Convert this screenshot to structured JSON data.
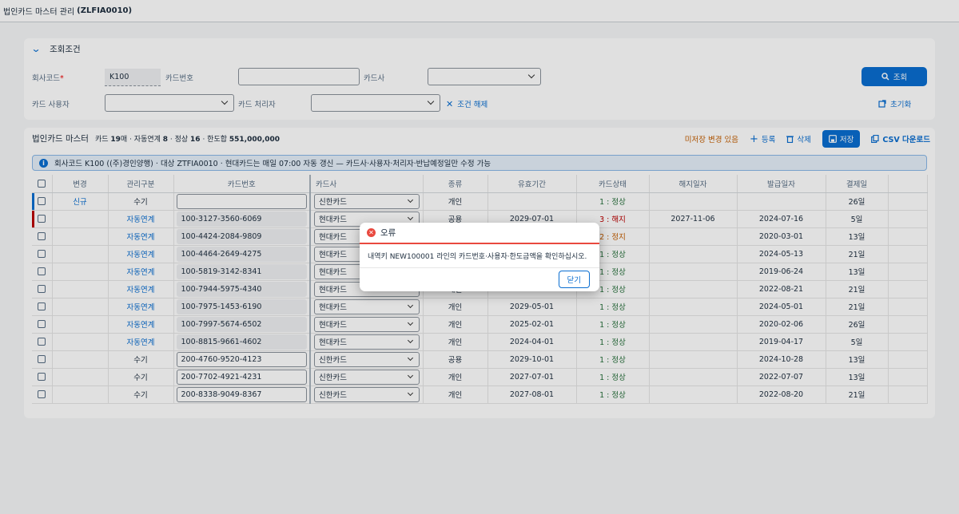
{
  "app": {
    "title_prefix": "법인카드 마스터 관리",
    "title_code": "(ZLFIA0010)"
  },
  "filter": {
    "section_title": "조회조건",
    "company_code_label": "회사코드",
    "required_mark": "*",
    "company_code_value": "K100",
    "card_no_label": "카드번호",
    "card_no_value": "",
    "card_company_label": "카드사",
    "card_user_label": "카드 사용자",
    "card_processor_label": "카드 처리자",
    "clear_label": "조건 해제",
    "search_label": "조회",
    "reset_label": "초기화"
  },
  "table": {
    "title": "법인카드 마스터",
    "summary": {
      "p1": "카드 ",
      "cards": "19",
      "p2": "매 · 자동연계 ",
      "auto": "8",
      "p3": " · 정상 ",
      "normal": "16",
      "p4": " · 한도합 ",
      "limit": "551,000,000"
    },
    "unsaved": "미저장 변경 있음",
    "add": "등록",
    "delete": "삭제",
    "save": "저장",
    "csv": "CSV 다운로드",
    "info": "회사코드 K100 ((주)경인양행) · 대상 ZTFIA0010 · 현대카드는 매일 07:00 자동 갱신 — 카드사·사용자·처리자·반납예정일만 수정 가능",
    "columns": [
      "변경",
      "관리구분",
      "카드번호",
      "카드사",
      "종류",
      "유효기간",
      "카드상태",
      "해지일자",
      "발급일자",
      "결제일"
    ],
    "rows": [
      {
        "change": "신규",
        "mgmt": "수기",
        "card_no": "",
        "company": "신한카드",
        "kind": "개인",
        "valid": "",
        "status": "1 : 정상",
        "term": "",
        "issue": "",
        "pay": "26일"
      },
      {
        "change": "",
        "mgmt": "자동연계",
        "card_no": "100-3127-3560-6069",
        "company": "현대카드",
        "kind": "공용",
        "valid": "2029-07-01",
        "status": "3 : 해지",
        "term": "2027-11-06",
        "issue": "2024-07-16",
        "pay": "5일"
      },
      {
        "change": "",
        "mgmt": "자동연계",
        "card_no": "100-4424-2084-9809",
        "company": "현대카드",
        "kind": "",
        "valid": "",
        "status": "2 : 정지",
        "term": "",
        "issue": "2020-03-01",
        "pay": "13일"
      },
      {
        "change": "",
        "mgmt": "자동연계",
        "card_no": "100-4464-2649-4275",
        "company": "현대카드",
        "kind": "",
        "valid": "",
        "status": "1 : 정상",
        "term": "",
        "issue": "2024-05-13",
        "pay": "21일"
      },
      {
        "change": "",
        "mgmt": "자동연계",
        "card_no": "100-5819-3142-8341",
        "company": "현대카드",
        "kind": "",
        "valid": "",
        "status": "1 : 정상",
        "term": "",
        "issue": "2019-06-24",
        "pay": "13일"
      },
      {
        "change": "",
        "mgmt": "자동연계",
        "card_no": "100-7944-5975-4340",
        "company": "현대카드",
        "kind": "개인",
        "valid": "2027-08-01",
        "status": "1 : 정상",
        "term": "",
        "issue": "2022-08-21",
        "pay": "21일"
      },
      {
        "change": "",
        "mgmt": "자동연계",
        "card_no": "100-7975-1453-6190",
        "company": "현대카드",
        "kind": "개인",
        "valid": "2029-05-01",
        "status": "1 : 정상",
        "term": "",
        "issue": "2024-05-01",
        "pay": "21일"
      },
      {
        "change": "",
        "mgmt": "자동연계",
        "card_no": "100-7997-5674-6502",
        "company": "현대카드",
        "kind": "개인",
        "valid": "2025-02-01",
        "status": "1 : 정상",
        "term": "",
        "issue": "2020-02-06",
        "pay": "26일"
      },
      {
        "change": "",
        "mgmt": "자동연계",
        "card_no": "100-8815-9661-4602",
        "company": "현대카드",
        "kind": "개인",
        "valid": "2024-04-01",
        "status": "1 : 정상",
        "term": "",
        "issue": "2019-04-17",
        "pay": "5일"
      },
      {
        "change": "",
        "mgmt": "수기",
        "card_no": "200-4760-9520-4123",
        "company": "신한카드",
        "kind": "공용",
        "valid": "2029-10-01",
        "status": "1 : 정상",
        "term": "",
        "issue": "2024-10-28",
        "pay": "13일"
      },
      {
        "change": "",
        "mgmt": "수기",
        "card_no": "200-7702-4921-4231",
        "company": "신한카드",
        "kind": "개인",
        "valid": "2027-07-01",
        "status": "1 : 정상",
        "term": "",
        "issue": "2022-07-07",
        "pay": "13일"
      },
      {
        "change": "",
        "mgmt": "수기",
        "card_no": "200-8338-9049-8367",
        "company": "신한카드",
        "kind": "개인",
        "valid": "2027-08-01",
        "status": "1 : 정상",
        "term": "",
        "issue": "2022-08-20",
        "pay": "21일"
      }
    ]
  },
  "dialog": {
    "title": "오류",
    "message": "내역키 NEW100001 라인의 카드번호·사용자·한도금액을 확인하십시오.",
    "close": "닫기"
  },
  "colors": {
    "accent": "#0a6ed1",
    "error": "#e9493f",
    "new_marker": "#0a6ed1",
    "changed_marker": "#bb0000"
  }
}
